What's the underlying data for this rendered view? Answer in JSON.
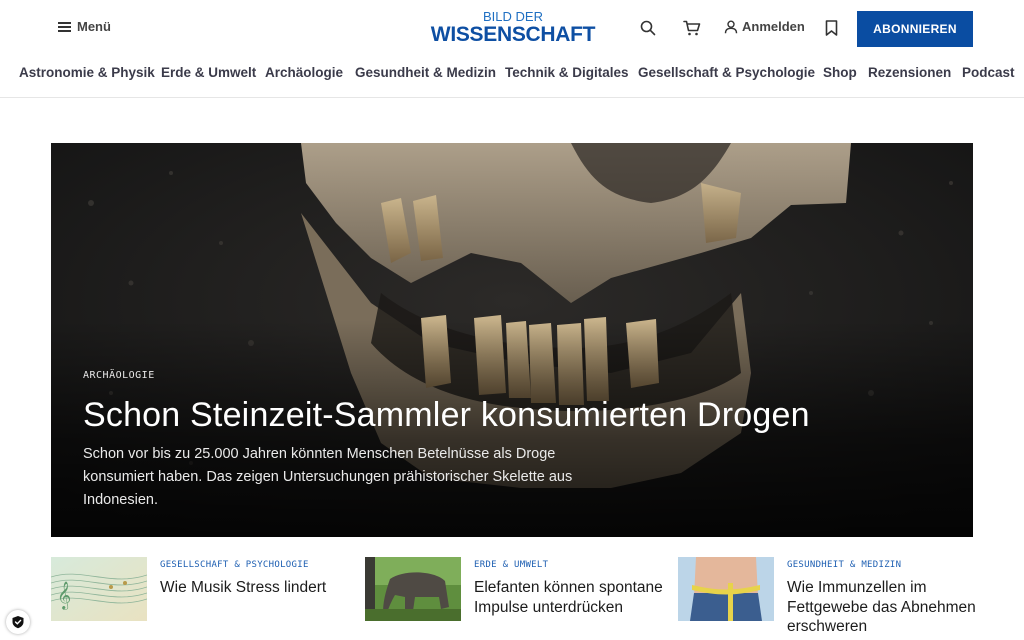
{
  "header": {
    "menu_label": "Menü",
    "logo_line1": "BILD DER",
    "logo_line2": "WISSENSCHAFT",
    "login_label": "Anmelden",
    "subscribe_label": "ABONNIEREN",
    "icons": [
      "menu-icon",
      "search-icon",
      "cart-icon",
      "user-icon",
      "bookmark-icon"
    ]
  },
  "nav": {
    "items": [
      "Astronomie & Physik",
      "Erde & Umwelt",
      "Archäologie",
      "Gesundheit & Medizin",
      "Technik & Digitales",
      "Gesellschaft & Psychologie",
      "Shop",
      "Rezensionen",
      "Podcast"
    ]
  },
  "hero": {
    "category": "ARCHÄOLOGIE",
    "title": "Schon Steinzeit-Sammler konsumierten Drogen",
    "teaser": "Schon vor bis zu 25.000 Jahren könnten Menschen Betelnüsse als Droge konsumiert haben. Das zeigen Untersuchungen prähistorischer Skelette aus Indonesien."
  },
  "cards": [
    {
      "category": "GESELLSCHAFT & PSYCHOLOGIE",
      "title": "Wie Musik Stress lindert"
    },
    {
      "category": "ERDE & UMWELT",
      "title": "Elefanten können spontane Impulse unterdrücken"
    },
    {
      "category": "GESUNDHEIT & MEDIZIN",
      "title": "Wie Immunzellen im Fettgewebe das Abnehmen erschweren"
    }
  ],
  "colors": {
    "brand_blue": "#0a4da2",
    "category_blue": "#1e5fb2",
    "nav_text": "#3b3b4a"
  }
}
